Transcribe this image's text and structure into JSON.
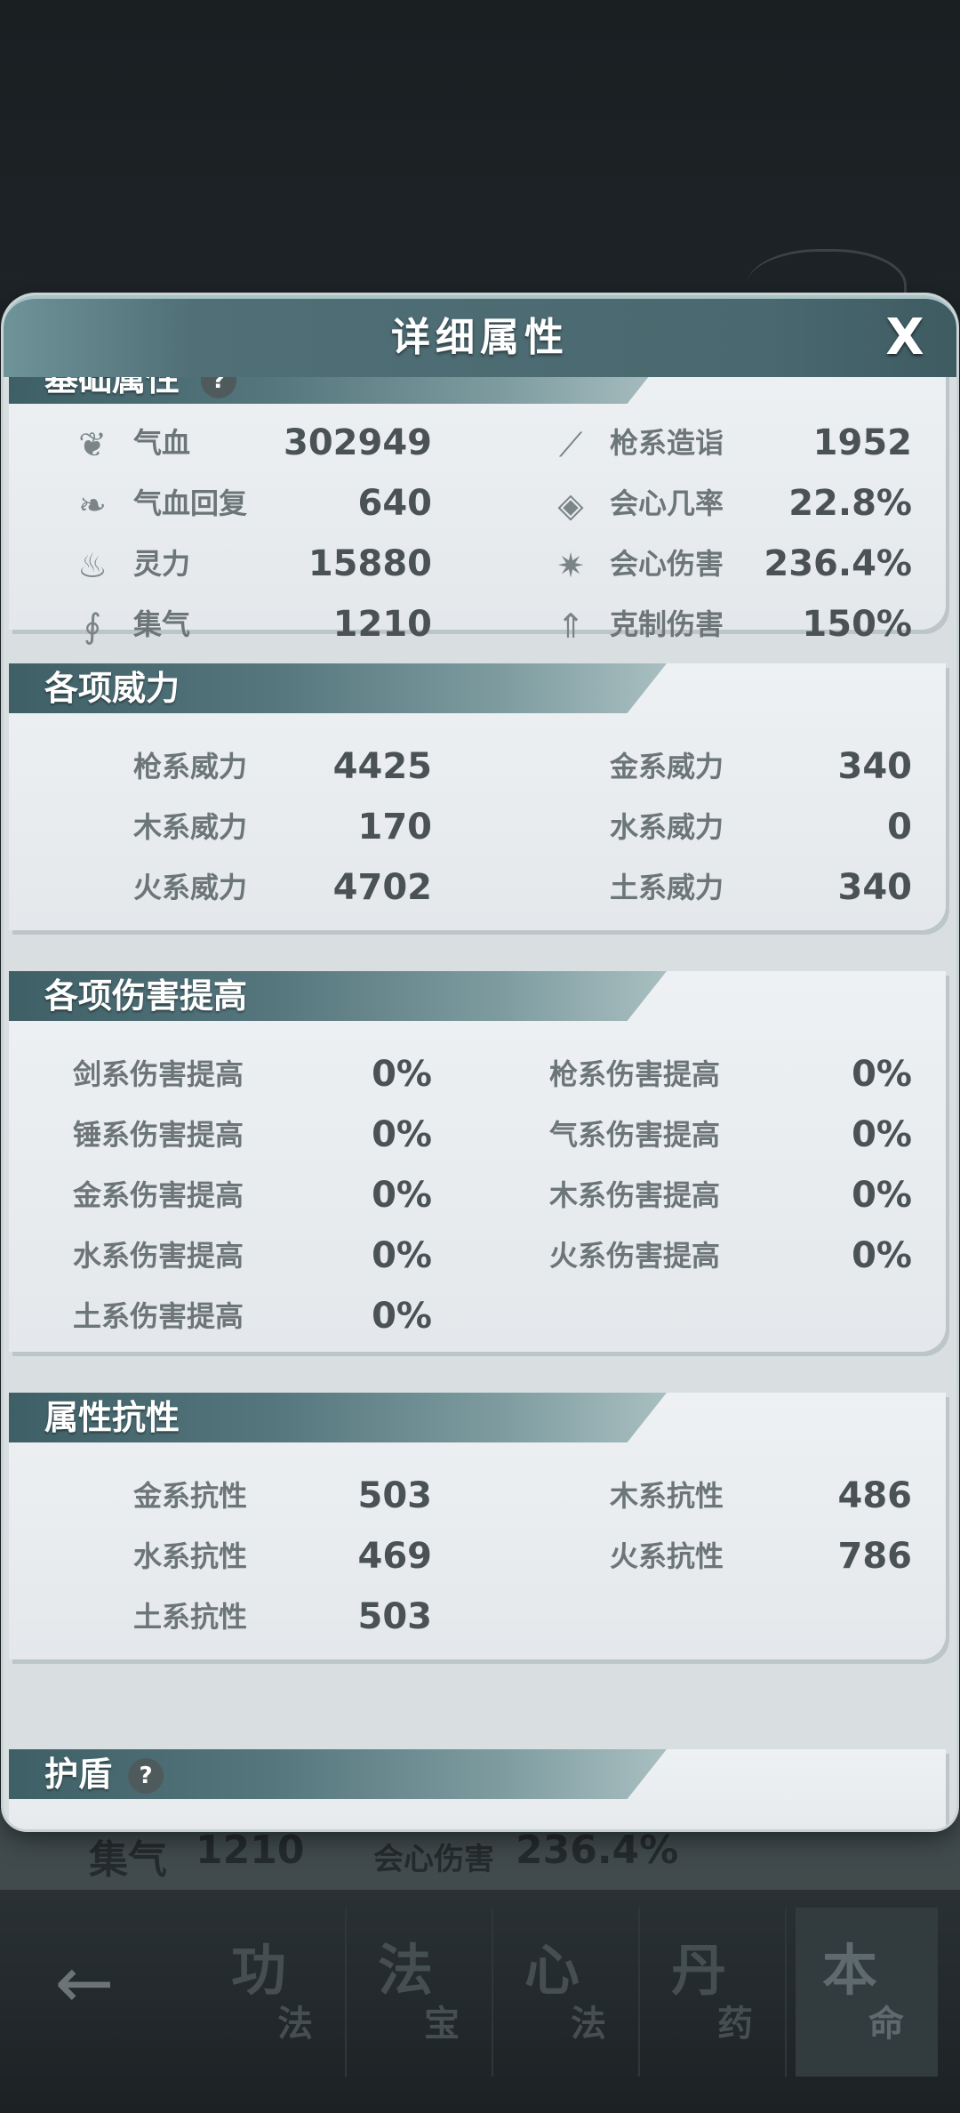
{
  "window": {
    "title": "详细属性",
    "close_label": "X"
  },
  "sections": {
    "basic": {
      "title": "基础属性",
      "help": "?",
      "left": [
        {
          "icon": "heart-icon",
          "label": "气血",
          "value": "302949"
        },
        {
          "icon": "double-heart-icon",
          "label": "气血回复",
          "value": "640"
        },
        {
          "icon": "flame-drop-icon",
          "label": "灵力",
          "value": "15880"
        },
        {
          "icon": "swirl-icon",
          "label": "集气",
          "value": "1210"
        }
      ],
      "right": [
        {
          "icon": "spear-icon",
          "label": "枪系造诣",
          "value": "1952"
        },
        {
          "icon": "crit-rate-icon",
          "label": "会心几率",
          "value": "22.8%"
        },
        {
          "icon": "burst-icon",
          "label": "会心伤害",
          "value": "236.4%"
        },
        {
          "icon": "arrow-up-icon",
          "label": "克制伤害",
          "value": "150%"
        }
      ]
    },
    "power": {
      "title": "各项威力",
      "left": [
        {
          "label": "枪系威力",
          "value": "4425"
        },
        {
          "label": "木系威力",
          "value": "170"
        },
        {
          "label": "火系威力",
          "value": "4702"
        }
      ],
      "right": [
        {
          "label": "金系威力",
          "value": "340"
        },
        {
          "label": "水系威力",
          "value": "0"
        },
        {
          "label": "土系威力",
          "value": "340"
        }
      ]
    },
    "damage": {
      "title": "各项伤害提高",
      "left": [
        {
          "label": "剑系伤害提高",
          "value": "0%"
        },
        {
          "label": "锤系伤害提高",
          "value": "0%"
        },
        {
          "label": "金系伤害提高",
          "value": "0%"
        },
        {
          "label": "水系伤害提高",
          "value": "0%"
        },
        {
          "label": "土系伤害提高",
          "value": "0%"
        }
      ],
      "right": [
        {
          "label": "枪系伤害提高",
          "value": "0%"
        },
        {
          "label": "气系伤害提高",
          "value": "0%"
        },
        {
          "label": "木系伤害提高",
          "value": "0%"
        },
        {
          "label": "火系伤害提高",
          "value": "0%"
        }
      ]
    },
    "resist": {
      "title": "属性抗性",
      "left": [
        {
          "label": "金系抗性",
          "value": "503"
        },
        {
          "label": "水系抗性",
          "value": "469"
        },
        {
          "label": "土系抗性",
          "value": "503"
        }
      ],
      "right": [
        {
          "label": "木系抗性",
          "value": "486"
        },
        {
          "label": "火系抗性",
          "value": "786"
        }
      ]
    },
    "shield": {
      "title": "护盾",
      "help": "?"
    }
  },
  "background_row": {
    "label": "集气",
    "value": "1210",
    "label2": "会心伤害",
    "value2": "236.4%"
  },
  "bottom_nav": {
    "back_icon": "←",
    "tabs": [
      {
        "big": "功",
        "small": "法"
      },
      {
        "big": "法",
        "small": "宝"
      },
      {
        "big": "心",
        "small": "法"
      },
      {
        "big": "丹",
        "small": "药"
      },
      {
        "big": "本",
        "small": "命"
      }
    ]
  }
}
